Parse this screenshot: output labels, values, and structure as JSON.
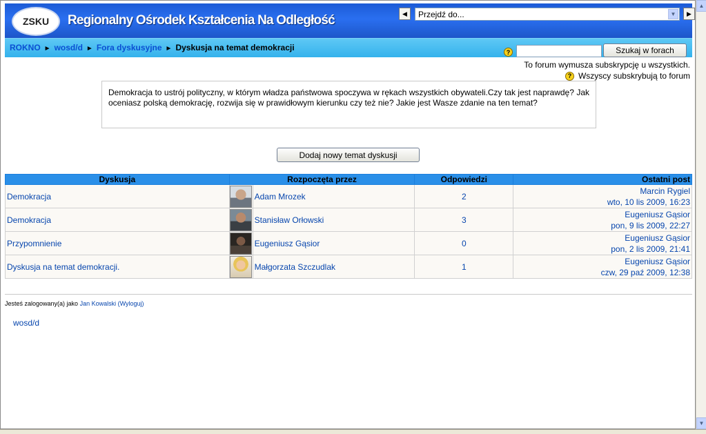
{
  "header": {
    "logo_text": "ZSKU",
    "site_title": "Regionalny Ośrodek Kształcenia Na Odległość",
    "jump_select": "Przejdź do..."
  },
  "breadcrumb": {
    "items": [
      "ROKNO",
      "wosd/d",
      "Fora dyskusyjne"
    ],
    "current": "Dyskusja na temat demokracji",
    "separator": "►"
  },
  "search": {
    "button_label": "Szukaj w foracH",
    "value": ""
  },
  "subscription": {
    "line1": "To forum wymusza subskrypcję u wszystkich.",
    "line2": "Wszyscy subskrybują to forum"
  },
  "intro_text": "Demokracja to ustrój polityczny, w którym władza państwowa spoczywa w rękach wszystkich obywateli.Czy tak jest naprawdę? Jak oceniasz polską demokrację, rozwija się w prawidłowym kierunku czy też nie? Jakie jest Wasze zdanie na ten temat?",
  "add_topic_label": "Dodaj nowy temat dyskusji",
  "table": {
    "headers": [
      "Dyskusja",
      "Rozpoczęta przez",
      "Odpowiedzi",
      "Ostatni post"
    ],
    "rows": [
      {
        "topic": "Demokracja",
        "author": "Adam Mrozek",
        "replies": "2",
        "last_author": "Marcin Rygiel",
        "last_date": "wto, 10 lis 2009, 16:23"
      },
      {
        "topic": "Demokracja",
        "author": "Stanisław Orłowski",
        "replies": "3",
        "last_author": "Eugeniusz Gąsior",
        "last_date": "pon, 9 lis 2009, 22:27"
      },
      {
        "topic": "Przypomnienie",
        "author": "Eugeniusz Gąsior",
        "replies": "0",
        "last_author": "Eugeniusz Gąsior",
        "last_date": "pon, 2 lis 2009, 21:41"
      },
      {
        "topic": "Dyskusja na temat demokracji.",
        "author": "Małgorzata Szczudlak",
        "replies": "1",
        "last_author": "Eugeniusz Gąsior",
        "last_date": "czw, 29 paź 2009, 12:38"
      }
    ]
  },
  "footer": {
    "logged_prefix": "Jesteś zalogowany(a) jako",
    "user": "Jan Kowalski",
    "logout": "(Wyloguj)",
    "bottom_link": "wosd/d"
  }
}
